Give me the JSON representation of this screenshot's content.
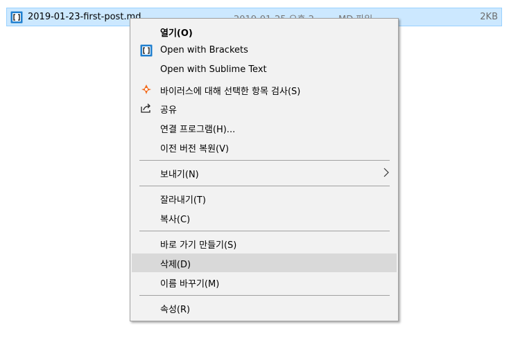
{
  "file": {
    "name": "2019-01-23-first-post.md",
    "date": "2019-01-25 오후 2...",
    "type": "MD 파일",
    "size": "2KB"
  },
  "menu": {
    "open": "열기(O)",
    "open_brackets": "Open with Brackets",
    "open_sublime": "Open with Sublime Text",
    "scan_virus": "바이러스에 대해 선택한 항목 검사(S)",
    "share": "공유",
    "open_with": "연결 프로그램(H)...",
    "restore_versions": "이전 버전 복원(V)",
    "send_to": "보내기(N)",
    "cut": "잘라내기(T)",
    "copy": "복사(C)",
    "create_shortcut": "바로 가기 만들기(S)",
    "delete": "삭제(D)",
    "rename": "이름 바꾸기(M)",
    "properties": "속성(R)"
  },
  "colors": {
    "selection_bg": "#cce8ff",
    "selection_border": "#99d1ff",
    "menu_bg": "#f2f2f2",
    "hover_bg": "#d9d9d9",
    "brackets_blue": "#1f7fcf",
    "avast_orange": "#f26b1d"
  },
  "icons": {
    "file": "brackets-file-icon",
    "brackets": "brackets-icon",
    "avast": "avast-icon",
    "share": "share-icon",
    "submenu": "chevron-right-icon"
  }
}
